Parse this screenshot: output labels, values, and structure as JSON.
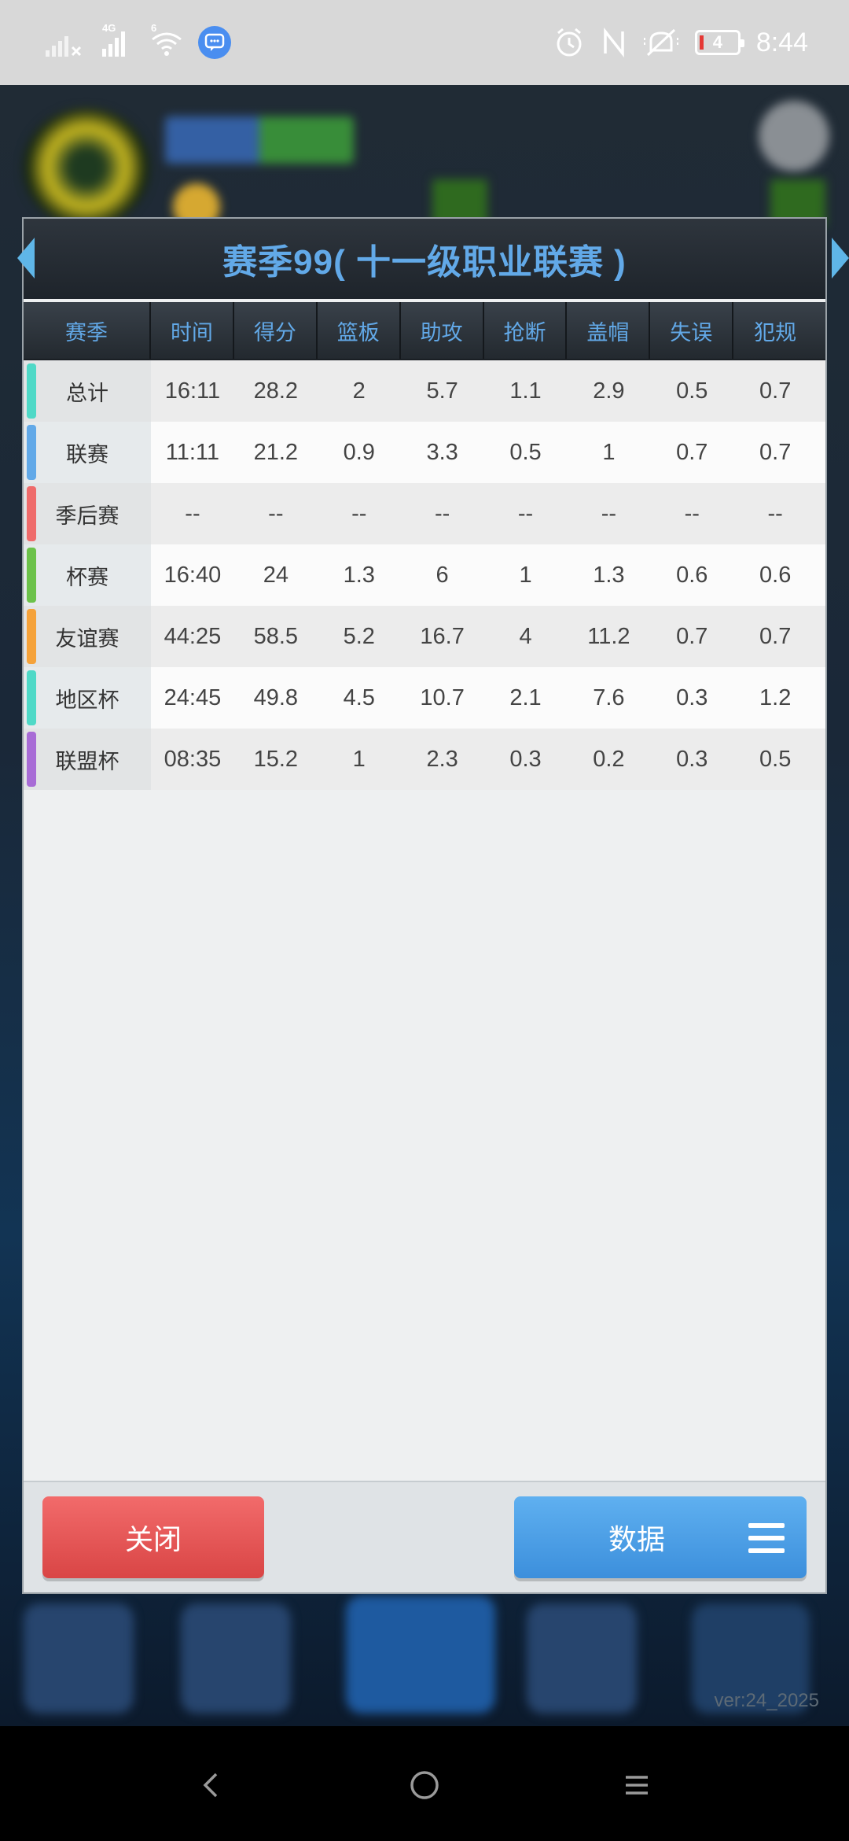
{
  "status_bar": {
    "time": "8:44",
    "battery_level": "4",
    "network_label": "4G",
    "wifi_label": "6",
    "icons": [
      "signal-icon",
      "signal-4g-icon",
      "wifi-icon",
      "message-icon",
      "alarm-icon",
      "nfc-icon",
      "mute-icon",
      "battery-icon"
    ]
  },
  "background": {
    "version": "ver:24_2025"
  },
  "dialog": {
    "title": "赛季99( 十一级职业联赛 )",
    "columns": [
      "赛季",
      "时间",
      "得分",
      "篮板",
      "助攻",
      "抢断",
      "盖帽",
      "失误",
      "犯规"
    ],
    "rows": [
      {
        "season": "总计",
        "color": "#4fd9c7",
        "values": [
          "16:11",
          "28.2",
          "2",
          "5.7",
          "1.1",
          "2.9",
          "0.5",
          "0.7"
        ]
      },
      {
        "season": "联赛",
        "color": "#62a9e8",
        "values": [
          "11:11",
          "21.2",
          "0.9",
          "3.3",
          "0.5",
          "1",
          "0.7",
          "0.7"
        ]
      },
      {
        "season": "季后赛",
        "color": "#ef6b6b",
        "values": [
          "--",
          "--",
          "--",
          "--",
          "--",
          "--",
          "--",
          "--"
        ]
      },
      {
        "season": "杯赛",
        "color": "#6cc24a",
        "values": [
          "16:40",
          "24",
          "1.3",
          "6",
          "1",
          "1.3",
          "0.6",
          "0.6"
        ]
      },
      {
        "season": "友谊赛",
        "color": "#f5a23a",
        "values": [
          "44:25",
          "58.5",
          "5.2",
          "16.7",
          "4",
          "11.2",
          "0.7",
          "0.7"
        ]
      },
      {
        "season": "地区杯",
        "color": "#4fd9c7",
        "values": [
          "24:45",
          "49.8",
          "4.5",
          "10.7",
          "2.1",
          "7.6",
          "0.3",
          "1.2"
        ]
      },
      {
        "season": "联盟杯",
        "color": "#a86cd6",
        "values": [
          "08:35",
          "15.2",
          "1",
          "2.3",
          "0.3",
          "0.2",
          "0.3",
          "0.5"
        ]
      }
    ],
    "buttons": {
      "close_label": "关闭",
      "data_label": "数据"
    }
  },
  "colors": {
    "accent_blue": "#62a9e8",
    "close_red": "#e25555",
    "data_blue": "#4a9ce6"
  }
}
